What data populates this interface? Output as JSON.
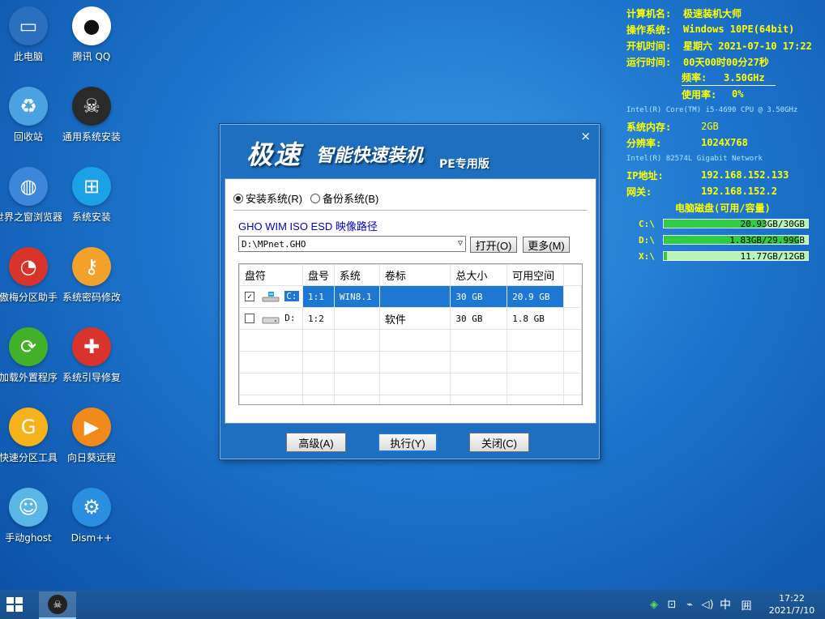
{
  "desktop_icons": [
    {
      "label": "此电脑",
      "icon": "computer-icon",
      "color": "#2b6fbf"
    },
    {
      "label": "腾讯 QQ",
      "icon": "qq-penguin-icon",
      "color": "#ffffff"
    },
    {
      "label": "回收站",
      "icon": "recycle-bin-icon",
      "color": "#4aa3e0"
    },
    {
      "label": "通用系统安装",
      "icon": "ghost-skull-icon",
      "color": "#2a2a2a"
    },
    {
      "label": "世界之窗浏览器",
      "icon": "globe-icon",
      "color": "#3d86d9"
    },
    {
      "label": "系统安装",
      "icon": "windows-logo-icon",
      "color": "#1ca0e6"
    },
    {
      "label": "傲梅分区助手",
      "icon": "partition-disk-icon",
      "color": "#d9342b"
    },
    {
      "label": "系统密码修改",
      "icon": "key-icon",
      "color": "#f2a22a"
    },
    {
      "label": "加载外置程序",
      "icon": "refresh-arrows-icon",
      "color": "#43b02a"
    },
    {
      "label": "系统引导修复",
      "icon": "first-aid-kit-icon",
      "color": "#d9342b"
    },
    {
      "label": "快速分区工具",
      "icon": "partition-g-icon",
      "color": "#f5b21b"
    },
    {
      "label": "向日葵远程",
      "icon": "sunflower-remote-icon",
      "color": "#f28a1b"
    },
    {
      "label": "手动ghost",
      "icon": "ghost-icon",
      "color": "#5bb6e8"
    },
    {
      "label": "Dism++",
      "icon": "gears-icon",
      "color": "#2a8fe0"
    }
  ],
  "sysinfo": {
    "rows": [
      {
        "k": "计算机名:",
        "v": "极速装机大师"
      },
      {
        "k": "操作系统:",
        "v": "Windows 10PE(64bit)"
      },
      {
        "k": "开机时间:",
        "v": "星期六 2021-07-10 17:22"
      },
      {
        "k": "运行时间:",
        "v": "00天00时00分27秒"
      }
    ],
    "freq_label": "频率:",
    "freq_value": "3.50GHz",
    "usage_label": "使用率:",
    "usage_value": "0%",
    "cpu_model": "Intel(R) Core(TM) i5-4690 CPU @ 3.50GHz",
    "mem_label": "系统内存:",
    "mem_value": "2GB",
    "res_label": "分辨率:",
    "res_value": "1024X768",
    "nic": "Intel(R) 82574L Gigabit Network",
    "ip_label": "IP地址:",
    "ip_value": "192.168.152.133",
    "gw_label": "网关:",
    "gw_value": "192.168.152.2",
    "disk_title": "电脑磁盘(可用/容量)",
    "disks": [
      {
        "letter": "C:\\",
        "text": "20.93GB/30GB",
        "free_fraction": 0.7
      },
      {
        "letter": "D:\\",
        "text": "1.83GB/29.99GB",
        "free_fraction": 0.94
      },
      {
        "letter": "X:\\",
        "text": "11.77GB/12GB",
        "free_fraction": 0.02
      }
    ]
  },
  "dialog": {
    "brand_main": "极速",
    "brand_sub": "智能快速装机",
    "brand_pe": "PE专用版",
    "close": "×",
    "radio_install": "安装系统(R)",
    "radio_backup": "备份系统(B)",
    "path_label": "GHO WIM ISO ESD 映像路径",
    "path_value": "D:\\MPnet.GHO",
    "open_button": "打开(O)",
    "more_button": "更多(M)",
    "columns": [
      "盘符",
      "盘号",
      "系统",
      "卷标",
      "总大小",
      "可用空间"
    ],
    "rows": [
      {
        "drive": "C:",
        "num": "1:1",
        "sys": "WIN8.1",
        "label": "",
        "total": "30 GB",
        "free": "20.9 GB"
      },
      {
        "drive": "D:",
        "num": "1:2",
        "sys": "",
        "label": "软件",
        "total": "30 GB",
        "free": "1.8 GB"
      }
    ],
    "advanced_button": "高级(A)",
    "execute_button": "执行(Y)",
    "close_button": "关闭(C)"
  },
  "taskbar": {
    "tray_icons": [
      "shield-icon",
      "network-icon",
      "usb-icon",
      "speaker-icon"
    ],
    "ime": "中",
    "keyboard": "囲",
    "time": "17:22",
    "date": "2021/7/10"
  }
}
